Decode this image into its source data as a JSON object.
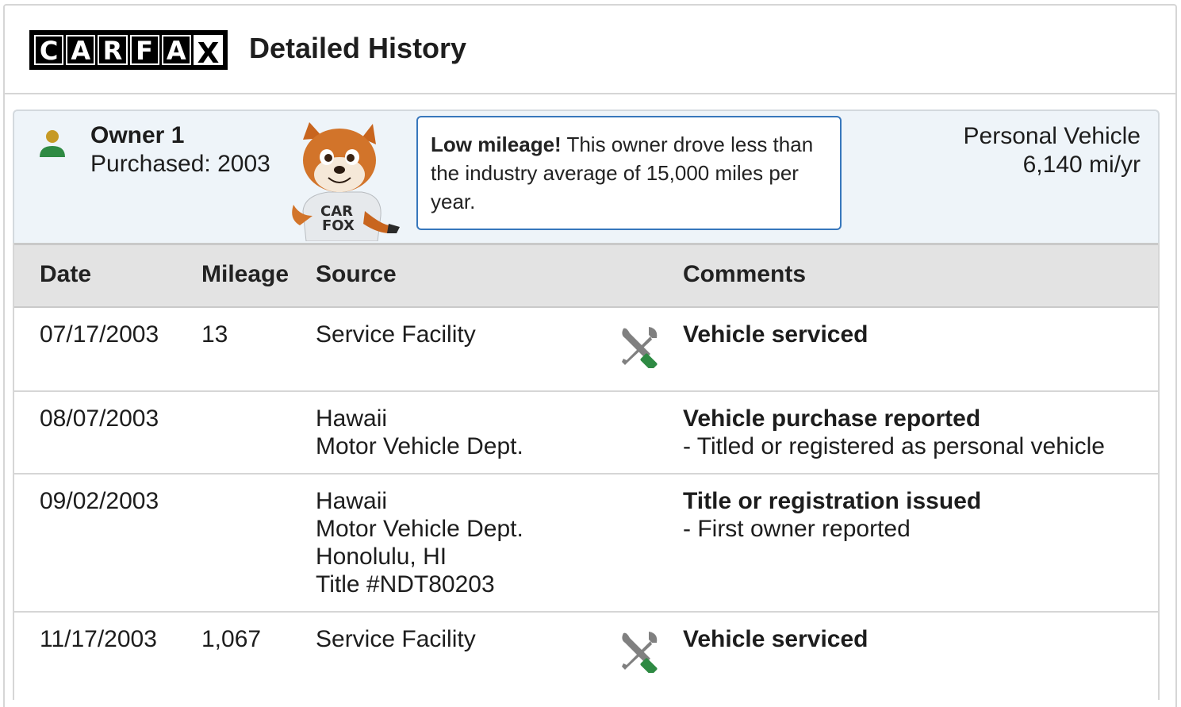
{
  "header": {
    "logo_letters": [
      "C",
      "A",
      "R",
      "F",
      "A",
      "X"
    ],
    "title": "Detailed History"
  },
  "owner": {
    "name": "Owner 1",
    "purchased": "Purchased: 2003",
    "fox_shirt": "CAR FOX",
    "tip_bold": "Low mileage!",
    "tip_text": " This owner drove less than the industry average of 15,000 miles per year.",
    "vehicle_type": "Personal Vehicle",
    "mileage_per_year": "6,140 mi/yr"
  },
  "table": {
    "headers": {
      "date": "Date",
      "mileage": "Mileage",
      "source": "Source",
      "comments": "Comments"
    },
    "rows": [
      {
        "date": "07/17/2003",
        "mileage": "13",
        "source": [
          "Service Facility"
        ],
        "icon": "service-tools-icon",
        "comment_title": "Vehicle serviced",
        "comment_details": []
      },
      {
        "date": "08/07/2003",
        "mileage": "",
        "source": [
          "Hawaii",
          "Motor Vehicle Dept."
        ],
        "icon": "",
        "comment_title": "Vehicle purchase reported",
        "comment_details": [
          "- Titled or registered as personal vehicle"
        ]
      },
      {
        "date": "09/02/2003",
        "mileage": "",
        "source": [
          "Hawaii",
          "Motor Vehicle Dept.",
          "Honolulu, HI",
          "Title #NDT80203"
        ],
        "icon": "",
        "comment_title": "Title or registration issued",
        "comment_details": [
          "- First owner reported"
        ]
      },
      {
        "date": "11/17/2003",
        "mileage": "1,067",
        "source": [
          "Service Facility"
        ],
        "icon": "service-tools-icon",
        "comment_title": "Vehicle serviced",
        "comment_details": []
      }
    ]
  },
  "colors": {
    "owner_panel_bg": "#eef4f9",
    "tip_border": "#3777bc",
    "person_head": "#c69a26",
    "person_body": "#2e8a43",
    "wrench_gray": "#808080",
    "screwdriver_green": "#2e8a43"
  }
}
